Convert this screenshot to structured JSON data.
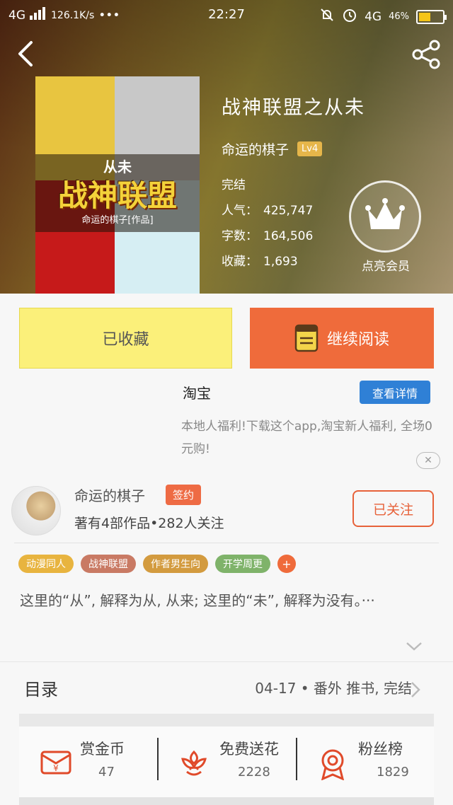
{
  "status_bar": {
    "network": "4G",
    "speed": "126.1K/s",
    "dots": "•••",
    "time": "22:27",
    "network_right": "4G",
    "battery": "46%"
  },
  "book": {
    "title": "战神联盟之从未",
    "author": "命运的棋子",
    "level": "Lv4",
    "status": "完结",
    "popularity_label": "人气：",
    "popularity": "425,747",
    "words_label": "字数：",
    "words": "164,506",
    "favorites_label": "收藏：",
    "favorites": "1,693",
    "vip_label": "点亮会员",
    "cover_sub": "从未",
    "cover_title": "战神联盟",
    "cover_author": "命运的棋子[作品]"
  },
  "actions": {
    "collected": "已收藏",
    "continue_read": "继续阅读"
  },
  "ad": {
    "title": "淘宝",
    "detail_button": "查看详情",
    "description": "本地人福利!下载这个app,淘宝新人福利, 全场0元购!",
    "close_icon": "close-icon"
  },
  "author_card": {
    "name": "命运的棋子",
    "signed": "签约",
    "stats": "著有4部作品•282人关注",
    "follow_button": "已关注"
  },
  "tags": [
    {
      "label": "动漫同人",
      "color": "#e8b43f"
    },
    {
      "label": "战神联盟",
      "color": "#c97a64"
    },
    {
      "label": "作者男生向",
      "color": "#d39b3f"
    },
    {
      "label": "开学周更",
      "color": "#7fb36a"
    }
  ],
  "tag_add": "+",
  "summary": "这里的“从”, 解释为从, 从来; 这里的“未”, 解释为没有。···",
  "toc": {
    "label": "目录",
    "latest": "04-17 • 番外  推书, 完结"
  },
  "stats": [
    {
      "label": "赏金币",
      "value": "47",
      "icon": "red-envelope-icon",
      "color": "#e04a2a"
    },
    {
      "label": "免费送花",
      "value": "2228",
      "icon": "flower-icon",
      "color": "#e04a2a"
    },
    {
      "label": "粉丝榜",
      "value": "1829",
      "icon": "medal-icon",
      "color": "#e04a2a"
    }
  ]
}
